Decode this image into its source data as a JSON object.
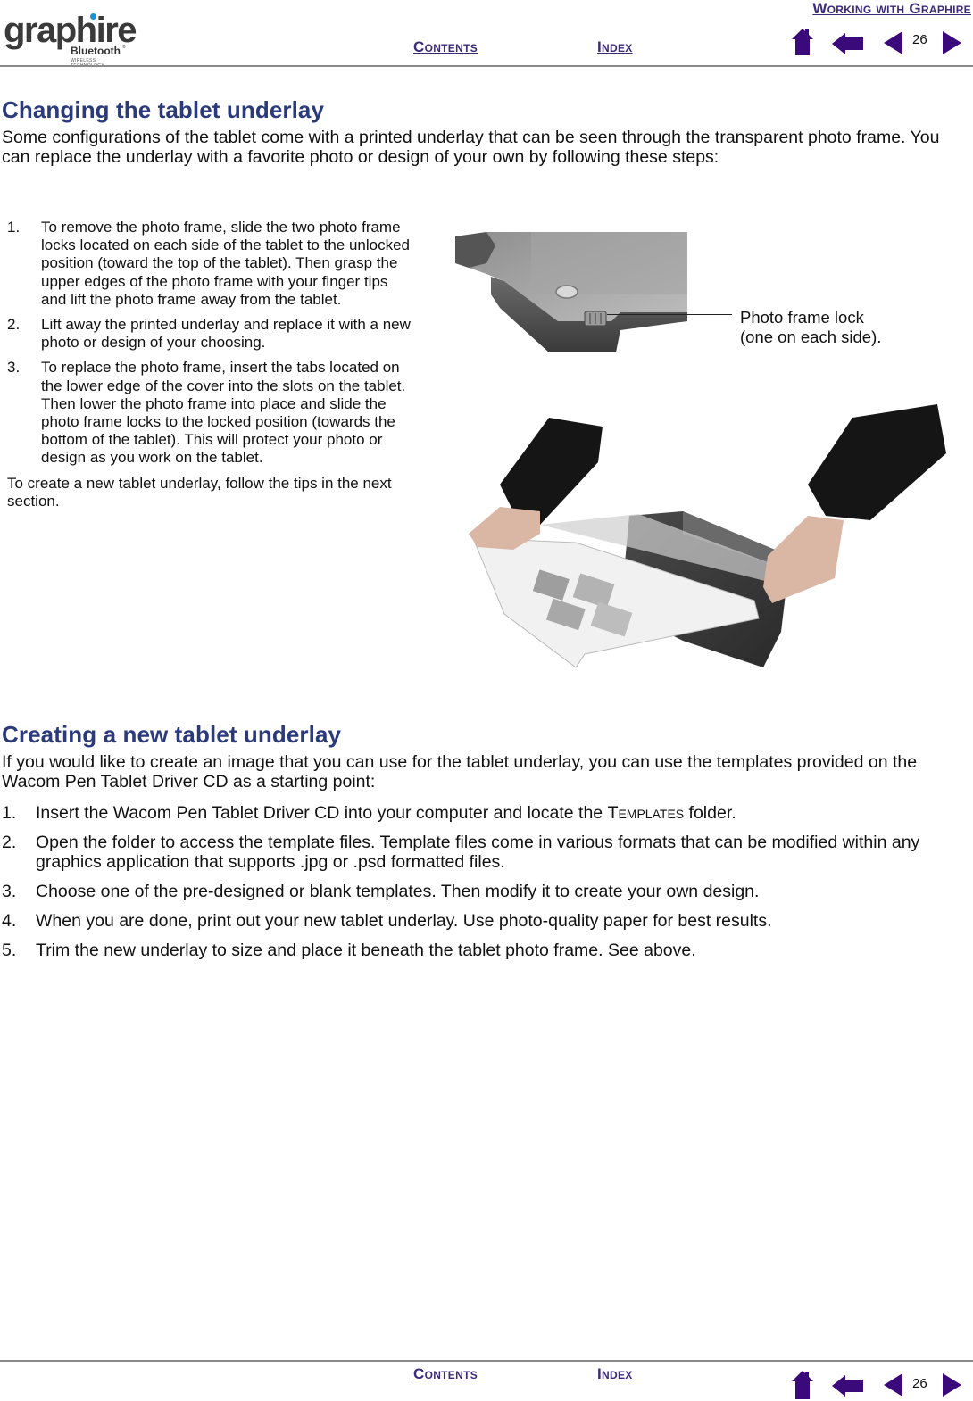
{
  "header": {
    "logo": {
      "wordmark": "graphire",
      "sub_brand": "Bluetooth",
      "trademark": "®",
      "tagline": "WIRELESS TECHNOLOGY"
    },
    "chapter_link": "Working with Graphire",
    "contents_link": "Contents",
    "index_link": "Index",
    "page_number": "26",
    "nav_icons": [
      "home-icon",
      "back-icon",
      "previous-page-icon",
      "next-page-icon"
    ]
  },
  "section1": {
    "title": "Changing the tablet underlay",
    "intro": "Some configurations of the tablet come with a printed underlay that can be seen through the transparent photo frame.  You can replace the underlay with a favorite photo or design of your own by following these steps:",
    "steps": [
      {
        "num": "1.",
        "text": "To remove the photo frame, slide the two photo frame locks located on each side of the tablet to the unlocked position (toward the top of the tablet).  Then grasp the upper edges of the photo frame with your finger tips and lift the photo frame away from the tablet."
      },
      {
        "num": "2.",
        "text": "Lift away the printed underlay and replace it with a new photo or design of your choosing."
      },
      {
        "num": "3.",
        "text": "To replace the photo frame, insert the tabs located on the lower edge of the cover into the slots on the tablet.  Then lower the photo frame into place and slide the photo frame locks to the locked position (towards the bottom of the tablet).  This will protect your photo or design as you work on the tablet."
      }
    ],
    "note": "To create a new tablet underlay, follow the tips in the next section.",
    "callout_line1": "Photo frame lock",
    "callout_line2": "(one on each side)."
  },
  "section2": {
    "title": "Creating a new tablet underlay",
    "intro": "If you would like to create an image that you can use for the tablet underlay, you can use the templates provided on the Wacom Pen Tablet Driver CD as a starting point:",
    "steps": [
      {
        "num": "1.",
        "before": "Insert the Wacom Pen Tablet Driver CD into your computer and locate the ",
        "smallcaps": "Templates",
        "after": " folder."
      },
      {
        "num": "2.",
        "text": "Open the folder to access the template files.  Template files come in various formats that can be modified within any graphics application that supports .jpg or .psd formatted files."
      },
      {
        "num": "3.",
        "text": "Choose one of the pre-designed or blank templates.  Then modify it to create your own design."
      },
      {
        "num": "4.",
        "text": "When you are done, print out your new tablet underlay.  Use photo-quality paper for best results."
      },
      {
        "num": "5.",
        "text": "Trim the new underlay to size and place it beneath the tablet photo frame.  See above."
      }
    ]
  },
  "footer": {
    "contents_link": "Contents",
    "index_link": "Index",
    "page_number": "26"
  },
  "colors": {
    "link": "#3c2a7a",
    "heading": "#2b3a7a",
    "nav_icon": "#3b0a7a",
    "rule": "#8a8a8a"
  }
}
